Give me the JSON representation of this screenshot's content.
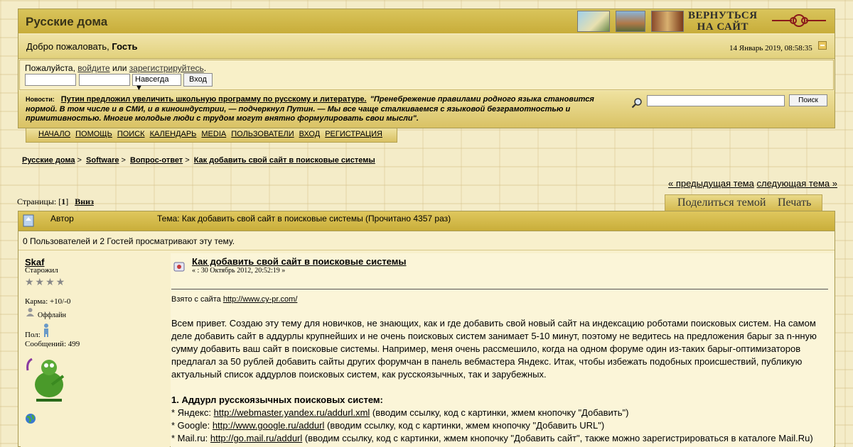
{
  "header": {
    "site_name": "Русские дома",
    "back_to_site_line1": "ВЕРНУТЬСЯ",
    "back_to_site_line2": "НА САЙТ",
    "welcome_prefix": "Добро пожаловать,",
    "welcome_user": "Гость",
    "datetime": "14 Январь 2019, 08:58:35"
  },
  "login": {
    "text_before": "Пожалуйста,",
    "login_link": "войдите",
    "text_or": "или",
    "register_link": "зарегистрируйтесь",
    "text_end": ".",
    "duration": "Навсегда ▼",
    "submit": "Вход"
  },
  "news": {
    "label": "Новости:",
    "headline": "Путин предложил увеличить школьную программу по русскому и литературе.",
    "quote": "\"Пренебрежение правилами родного языка становится нормой. В том числе и в СМИ, и в киноиндустрии, — подчеркнул Путин. — Мы все чаще сталкиваемся с языковой безграмотностью и примитивностью. Многие молодые люди с трудом могут внятно формулировать свои мысли\"."
  },
  "search": {
    "button": "Поиск"
  },
  "menu": [
    "НАЧАЛО",
    "ПОМОЩЬ",
    "ПОИСК",
    "КАЛЕНДАРЬ",
    "MEDIA",
    "ПОЛЬЗОВАТЕЛИ",
    "ВХОД",
    "РЕГИСТРАЦИЯ"
  ],
  "breadcrumb": [
    "Русские дома",
    "Software",
    "Вопрос-ответ",
    "Как добавить свой сайт в поисковые системы"
  ],
  "topic_nav": {
    "prev": "« предыдущая тема",
    "next": "следующая тема »"
  },
  "pages": {
    "label": "Страницы:",
    "current": "1",
    "down": "Вниз"
  },
  "actions": {
    "share": "Поделиться темой",
    "print": "Печать"
  },
  "topic_header": {
    "author": "Автор",
    "topic": "Тема: Как добавить свой сайт в поисковые системы  (Прочитано 4357 раз)"
  },
  "viewers": "0 Пользователей и 2 Гостей просматривают эту тему.",
  "poster": {
    "name": "Skaf",
    "rank": "Старожил",
    "stars": "★★★★",
    "karma": "Карма: +10/-0",
    "status": "Оффлайн",
    "gender": "Пол:",
    "posts": "Сообщений: 499"
  },
  "post": {
    "title": "Как добавить свой сайт в поисковые системы",
    "date": "« : 30 Октябрь 2012, 20:52:19 »",
    "source_prefix": "Взято с сайта",
    "source_url": "http://www.cy-pr.com/",
    "para1": "Всем привет. Создаю эту тему для новичков, не знающих, как и где добавить свой новый сайт на индексацию роботами поисковых систем. На самом деле добавить сайт в аддурлы крупнейших и не очень поисковых систем занимает 5-10 минут, поэтому не ведитесь на предложения барыг за n-нную сумму добавить ваш сайт в поисковые системы. Например, меня очень рассмешило, когда на одном форуме один из-таких барыг-оптимизаторов предлагал за 50 рублей добавить сайты других форумчан в панель вебмастера Яндекс. Итак, чтобы избежать подобных происшествий, публикую актуальный список аддурлов поисковых систем, как русскоязычных, так и зарубежных.",
    "section_title": "1. Аддурл русскоязычных поисковых систем:",
    "items": [
      {
        "prefix": "* Яндекс:",
        "url": "http://webmaster.yandex.ru/addurl.xml",
        "note": " (вводим ссылку, код с картинки, жмем кнопочку \"Добавить\")"
      },
      {
        "prefix": "* Google:",
        "url": "http://www.google.ru/addurl",
        "note": "  (вводим ссылку, код с картинки, жмем кнопочку \"Добавить URL\")"
      },
      {
        "prefix": "* Mail.ru:",
        "url": "http://go.mail.ru/addurl",
        "note": " (вводим ссылку, код с картинки, жмем кнопочку \"Добавить сайт\", также можно зарегистрироваться в каталоге Mail.Ru)"
      }
    ]
  }
}
